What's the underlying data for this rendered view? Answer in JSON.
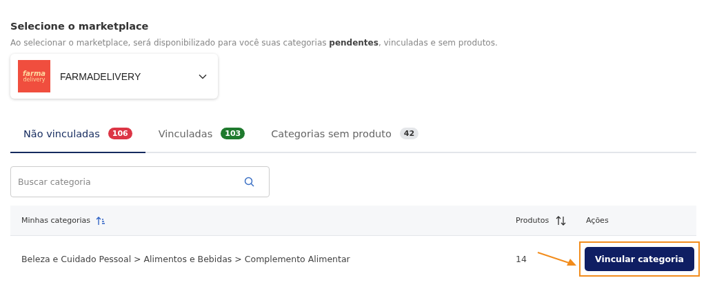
{
  "section": {
    "title": "Selecione o marketplace",
    "description": "Ao selecionar o marketplace, será disponibilizado para você suas categorias **pendentes**, vinculadas e sem produtos."
  },
  "marketplace_select": {
    "logo_text": "farma",
    "logo_subtext": "delivery",
    "value": "FARMADELIVERY"
  },
  "tabs": [
    {
      "label": "Não vinculadas",
      "count": "106",
      "color": "#dc3545",
      "selected": true
    },
    {
      "label": "Vinculadas",
      "count": "103",
      "color": "#1f7a2e",
      "selected": false
    },
    {
      "label": "Categorias sem produto",
      "count": "42",
      "color": "#e4e6e9",
      "selected": false
    }
  ],
  "search": {
    "placeholder": "Buscar categoria"
  },
  "table": {
    "columns": [
      "Minhas categorias",
      "Produtos",
      "Ações"
    ],
    "rows": [
      {
        "category": "Beleza e Cuidado Pessoal > Alimentos e Bebidas > Complemento Alimentar",
        "products": "14",
        "action": "Vincular categoria"
      }
    ]
  }
}
